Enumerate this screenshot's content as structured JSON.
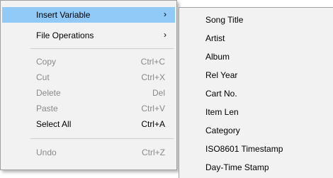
{
  "main_menu": {
    "items": [
      {
        "label": "Insert Variable",
        "shortcut": "",
        "arrow": "›",
        "state": "highlighted"
      },
      {
        "label": "File Operations",
        "shortcut": "",
        "arrow": "›",
        "state": "enabled"
      },
      {
        "label": "Copy",
        "shortcut": "Ctrl+C",
        "arrow": "",
        "state": "disabled"
      },
      {
        "label": "Cut",
        "shortcut": "Ctrl+X",
        "arrow": "",
        "state": "disabled"
      },
      {
        "label": "Delete",
        "shortcut": "Del",
        "arrow": "",
        "state": "disabled"
      },
      {
        "label": "Paste",
        "shortcut": "Ctrl+V",
        "arrow": "",
        "state": "disabled"
      },
      {
        "label": "Select All",
        "shortcut": "Ctrl+A",
        "arrow": "",
        "state": "enabled"
      },
      {
        "label": "Undo",
        "shortcut": "Ctrl+Z",
        "arrow": "",
        "state": "disabled"
      }
    ]
  },
  "submenu": {
    "items": [
      {
        "label": "Song Title"
      },
      {
        "label": "Artist"
      },
      {
        "label": "Album"
      },
      {
        "label": "Rel Year"
      },
      {
        "label": "Cart No."
      },
      {
        "label": "Item Len"
      },
      {
        "label": "Category"
      },
      {
        "label": "ISO8601 Timestamp"
      },
      {
        "label": "Day-Time Stamp"
      }
    ]
  },
  "colors": {
    "menu_background": "#f2f2f2",
    "highlight": "#91c9f7",
    "disabled_text": "#8a8a8a",
    "border": "#a0a0a0"
  }
}
